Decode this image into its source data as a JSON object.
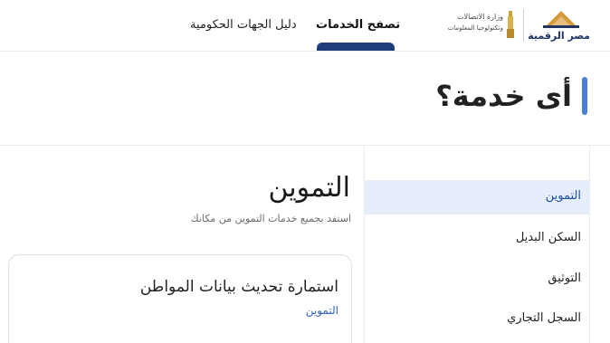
{
  "header": {
    "logo_text": "مصر الرقمية",
    "ministry_line1": "وزارة الاتصالات",
    "ministry_line2": "وتكنولوجيا المعلومات",
    "nav": [
      {
        "label": "تصفح الخدمات",
        "active": true
      },
      {
        "label": "دليل الجهات الحكومية",
        "active": false
      }
    ]
  },
  "hero": {
    "title": "أى خدمة؟"
  },
  "sidebar": {
    "items": [
      {
        "label": "التموين",
        "active": true
      },
      {
        "label": "السكن البديل",
        "active": false
      },
      {
        "label": "التوثيق",
        "active": false
      },
      {
        "label": "السجل التجاري",
        "active": false
      }
    ]
  },
  "main": {
    "category_title": "التموين",
    "category_subtitle": "استفد بجميع خدمات التموين من مكانك",
    "cards": [
      {
        "title": "استمارة تحديث بيانات المواطن",
        "tag": "التموين"
      }
    ]
  },
  "colors": {
    "accent": "#4a7fd6",
    "nav_active_underline": "#1e3d7a",
    "sidebar_active_bg": "#e6eefb",
    "link": "#2f62b8"
  },
  "icons": [
    "egypt-digital-logo-icon",
    "ministry-logo-icon"
  ]
}
